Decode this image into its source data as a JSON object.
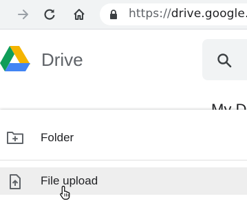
{
  "browser": {
    "back_icon": "arrow-left-icon",
    "forward_icon": "arrow-right-icon",
    "reload_icon": "reload-icon",
    "home_icon": "home-icon",
    "lock_icon": "lock-icon",
    "url_scheme": "https://",
    "url_host": "drive.google.c"
  },
  "header": {
    "app_name": "Drive",
    "search_icon": "search-icon"
  },
  "main": {
    "title": "My D"
  },
  "new_menu": {
    "items": [
      {
        "label": "Folder",
        "icon": "new-folder-icon"
      },
      {
        "label": "File upload",
        "icon": "file-upload-icon",
        "hovered": true
      }
    ]
  },
  "colors": {
    "toolbar_bg": "#f1f3f4",
    "hover_bg": "#eeeeee",
    "text": "#202124",
    "icon": "#5f6368",
    "logo_green": "#0f9d58",
    "logo_yellow": "#f4b400",
    "logo_blue": "#4285f4"
  }
}
